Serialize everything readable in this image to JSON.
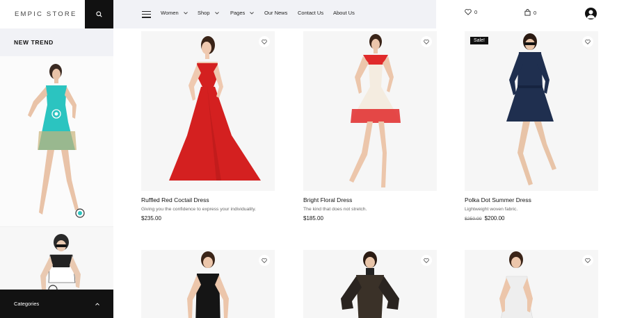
{
  "header": {
    "brand": "EMPIC STORE",
    "nav": [
      "Women",
      "Shop",
      "Pages",
      "Our News",
      "Contact Us",
      "About Us"
    ],
    "wishlist_count": "0",
    "cart_count": "0"
  },
  "sidebar": {
    "title": "NEW TREND",
    "categories_label": "Categories"
  },
  "products": [
    {
      "name": "Ruffled Red Coctail Dress",
      "desc": "Giving you the confidence to express your individuality.",
      "price": "$235.00"
    },
    {
      "name": "Bright Floral Dress",
      "desc": "The kind that does not stretch.",
      "price": "$185.00"
    },
    {
      "name": "Polka Dot Summer Dress",
      "desc": "Lightweight woven fabric.",
      "old_price": "$250.00",
      "price": "$200.00",
      "badge": "Sale!"
    }
  ],
  "colors": {
    "dark": "#111111",
    "nav_bg": "#f1f2f6",
    "red_dress": "#d42020",
    "teal_dress": "#2bc4c0",
    "navy_dress": "#1f2f4f"
  }
}
